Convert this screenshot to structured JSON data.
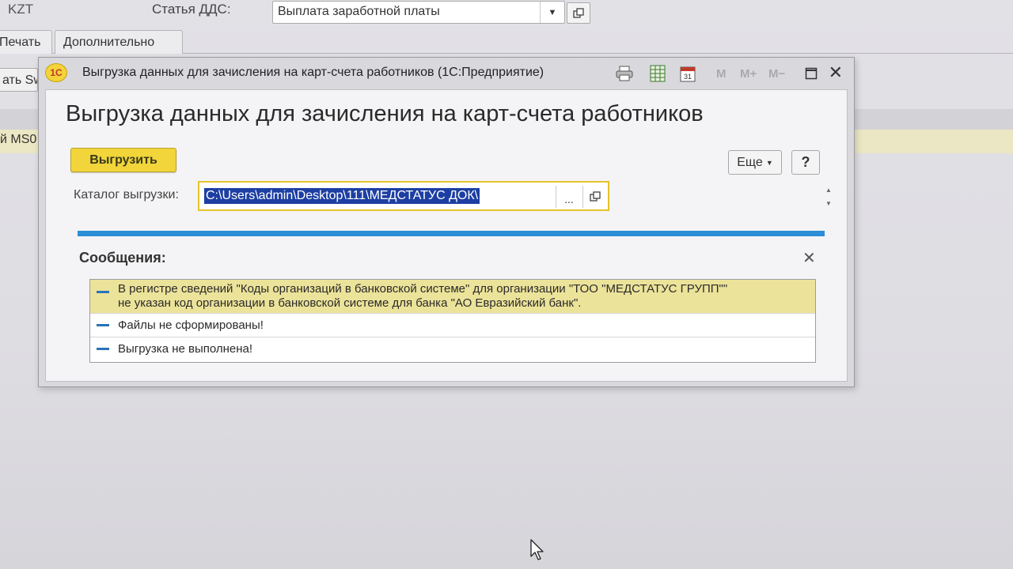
{
  "background": {
    "currency": "KZT",
    "dds_label": "Статья ДДС:",
    "dds_value": "Выплата заработной платы",
    "tabs": [
      "Печать",
      "Дополнительно"
    ],
    "sw_button": "ать Sw",
    "row_text": "й MS0"
  },
  "dialog": {
    "window_title": "Выгрузка данных для зачисления на карт-счета работников  (1С:Предприятие)",
    "logo": "1С",
    "toolbar": {
      "m": "M",
      "m_plus": "M+",
      "m_minus": "M−"
    },
    "form_title": "Выгрузка данных для зачисления на карт-счета работников",
    "export_button": "Выгрузить",
    "more_button": "Еще",
    "help_button": "?",
    "catalog_label": "Каталог выгрузки:",
    "catalog_value": "C:\\Users\\admin\\Desktop\\111\\МЕДСТАТУС ДОК\\",
    "catalog_select": "...",
    "messages_title": "Сообщения:",
    "messages": [
      {
        "line1": "В регистре сведений \"Коды организаций в банковской системе\" для организации \"ТОО \"МЕДСТАТУС ГРУПП\"\"",
        "line2": "не указан код организации в банковской системе для банка \"АО Евразийский банк\"."
      },
      {
        "line1": "Файлы не сформированы!"
      },
      {
        "line1": "Выгрузка не выполнена!"
      }
    ]
  },
  "colors": {
    "accent_yellow": "#f1d53a",
    "selection_blue": "#1d3fa3",
    "progress_blue": "#2b8ed6",
    "message_highlight": "#ece39a"
  }
}
